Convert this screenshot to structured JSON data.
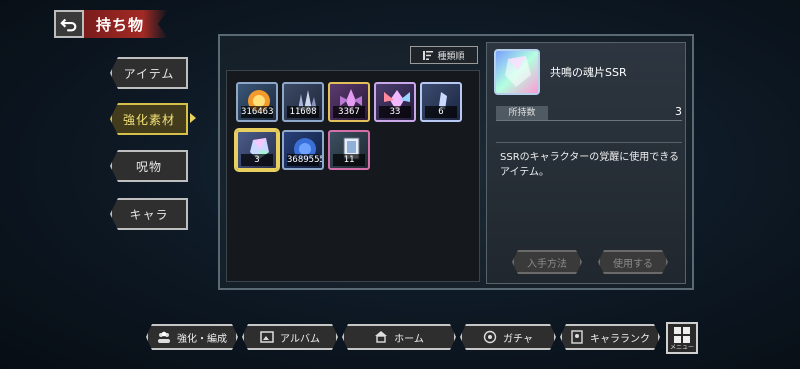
{
  "header": {
    "title": "持ち物"
  },
  "tabs": [
    {
      "label": "アイテム",
      "active": false
    },
    {
      "label": "強化素材",
      "active": true
    },
    {
      "label": "呪物",
      "active": false
    },
    {
      "label": "キャラ",
      "active": false
    }
  ],
  "sort": {
    "label": "種類順",
    "icon": "sort-icon"
  },
  "items": [
    {
      "count": "316463",
      "icon": "fire-orb-icon",
      "color": "#e07a20"
    },
    {
      "count": "11608",
      "icon": "blue-crystal-cluster-icon",
      "color": "#7e8cb4"
    },
    {
      "count": "3367",
      "icon": "purple-crystal-shard-icon",
      "color": "#b97acc"
    },
    {
      "count": "33",
      "icon": "prism-crystal-icon",
      "color": "#c58fd8"
    },
    {
      "count": "6",
      "icon": "small-soul-shard-icon",
      "color": "#9fb8e8"
    },
    {
      "count": "3",
      "icon": "soul-shard-ssr-icon",
      "color": "#b4d0ff"
    },
    {
      "count": "3689555",
      "icon": "blue-orb-icon",
      "color": "#3b6fd8"
    },
    {
      "count": "11",
      "icon": "card-icon",
      "color": "#d36fa9"
    }
  ],
  "detail": {
    "name": "共鳴の魂片SSR",
    "held_label": "所持数",
    "held_value": "3",
    "description": "SSRのキャラクターの覚醒に使用できるアイテム。",
    "acquire_label": "入手方法",
    "use_label": "使用する"
  },
  "nav": [
    {
      "label": "強化・編成",
      "icon": "team-icon"
    },
    {
      "label": "アルバム",
      "icon": "album-icon"
    },
    {
      "label": "ホーム",
      "icon": "home-icon"
    },
    {
      "label": "ガチャ",
      "icon": "gacha-icon"
    },
    {
      "label": "キャラランク",
      "icon": "rank-icon"
    }
  ],
  "menu": {
    "label": "メニュー"
  }
}
